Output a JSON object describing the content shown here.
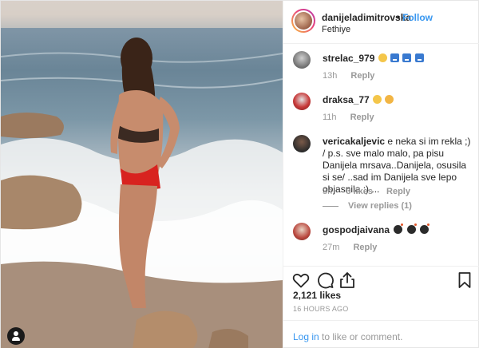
{
  "header": {
    "username": "danijeladimitrovska",
    "separator": "•",
    "follow_label": "Follow",
    "location": "Fethiye"
  },
  "comments": [
    {
      "username": "strelac_979",
      "text": "",
      "time": "13h",
      "reply_label": "Reply"
    },
    {
      "username": "draksa_77",
      "text": "",
      "time": "11h",
      "reply_label": "Reply"
    },
    {
      "username": "vericakaljevic",
      "text": "e neka si im rekla ;) / p.s. sve malo malo, pa pisu Danijela mrsava..Danijela, osusila si se/ ..sad im Danijela sve lepo objasnila ;) ...",
      "time": "3h",
      "likes": "3 likes",
      "reply_label": "Reply",
      "view_replies": "View replies (1)"
    },
    {
      "username": "gospodjaivana",
      "text": "",
      "time": "27m",
      "reply_label": "Reply"
    }
  ],
  "actions": {
    "likes": "2,121 likes",
    "timestamp": "16 HOURS AGO"
  },
  "login": {
    "link_text": "Log in",
    "suffix": " to like or comment."
  },
  "icons": {
    "like": "heart-icon",
    "comment": "comment-bubble-icon",
    "share": "share-icon",
    "save": "bookmark-icon",
    "tag": "user-tag-icon"
  },
  "colors": {
    "link_blue": "#3897f0",
    "text": "#262626",
    "muted": "#999999"
  }
}
